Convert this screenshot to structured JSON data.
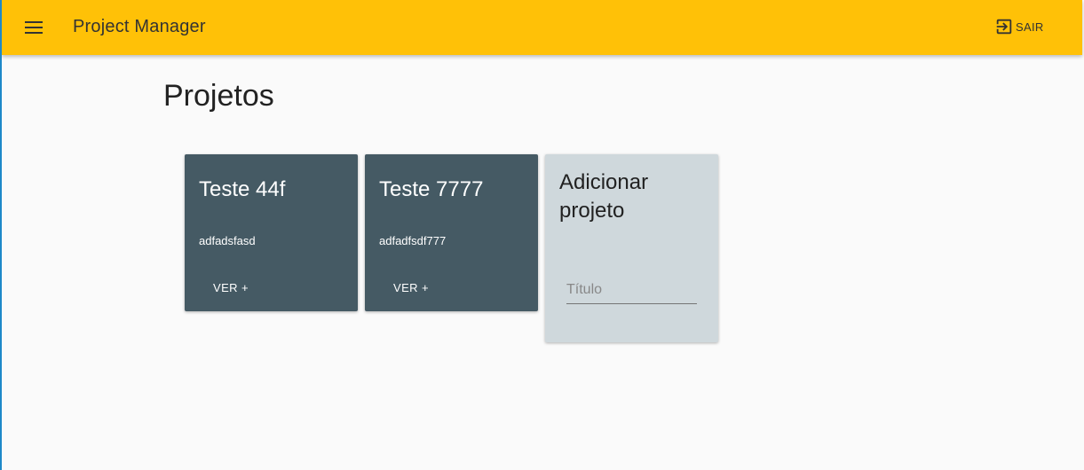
{
  "toolbar": {
    "menu_icon": "menu-icon",
    "title": "Project Manager",
    "logout_icon": "exit-to-app-icon",
    "logout_label": "SAIR",
    "color": "#ffc107"
  },
  "page": {
    "title": "Projetos"
  },
  "projects": [
    {
      "title": "Teste 44f",
      "description": "adfadsfasd",
      "action_label": "VER +"
    },
    {
      "title": "Teste 7777",
      "description": "adfadfsdf777",
      "action_label": "VER +"
    }
  ],
  "add_project": {
    "title": "Adicionar projeto",
    "input_placeholder": "Título",
    "input_value": ""
  },
  "colors": {
    "card_dark": "#455a64",
    "card_light": "#cfd8dc",
    "background": "#fafafa"
  }
}
